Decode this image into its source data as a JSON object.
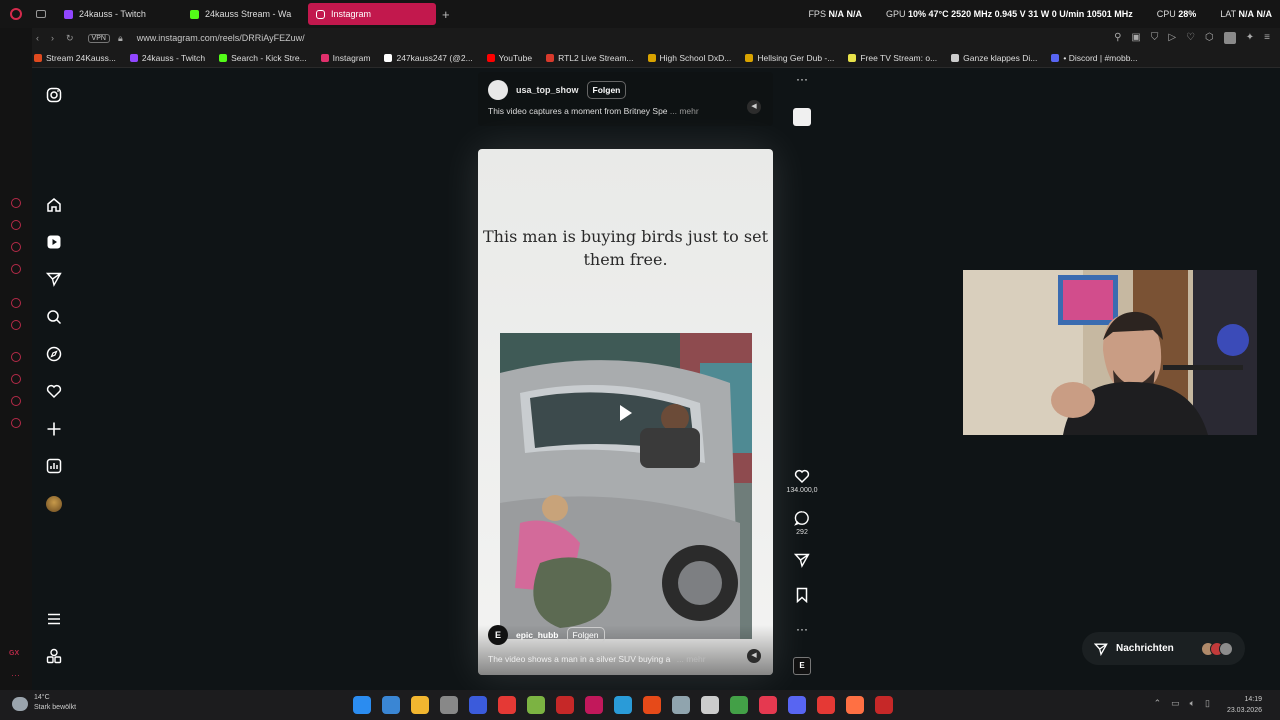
{
  "tabs": [
    {
      "label": "24kauss - Twitch",
      "color": "#9146ff",
      "active": false
    },
    {
      "label": "24kauss Stream - Wa",
      "color": "#53fc18",
      "active": false
    },
    {
      "label": "Instagram",
      "color": "#ffffff",
      "active": true
    }
  ],
  "stats": {
    "fps_label": "FPS",
    "fps_val": "N/A",
    "fps_val2": "N/A",
    "gpu_label": "GPU",
    "gpu_vals": "10% 47°C 2520 MHz 0.945 V 31 W 0 U/min 10501 MHz",
    "cpu_label": "CPU",
    "cpu_val": "28%",
    "lat_label": "LAT",
    "lat_val": "N/A",
    "lat_val2": "N/A"
  },
  "address": {
    "vpn": "VPN",
    "url": "www.instagram.com/reels/DRRiAyFEZuw/"
  },
  "bookmarks": [
    {
      "label": "Stream 24Kauss...",
      "color": "#e04a1f"
    },
    {
      "label": "24kauss - Twitch",
      "color": "#9146ff"
    },
    {
      "label": "Search - Kick Stre...",
      "color": "#53fc18"
    },
    {
      "label": "Instagram",
      "color": "#e1306c"
    },
    {
      "label": "247kauss247 (@2...",
      "color": "#ffffff"
    },
    {
      "label": "YouTube",
      "color": "#ff0000"
    },
    {
      "label": "RTL2 Live Stream...",
      "color": "#d83a2c"
    },
    {
      "label": "High School DxD...",
      "color": "#d9a300"
    },
    {
      "label": "Hellsing Ger Dub -...",
      "color": "#d9a300"
    },
    {
      "label": "Free TV Stream: o...",
      "color": "#e8e24a"
    },
    {
      "label": "Ganze klappes Di...",
      "color": "#cccccc"
    },
    {
      "label": "• Discord | #mobb...",
      "color": "#5865f2"
    }
  ],
  "reel_top": {
    "account": "usa_top_show",
    "follow": "Folgen",
    "caption": "This video captures a moment from Britney Spe",
    "more": "... mehr"
  },
  "reel_main": {
    "headline": "This man is buying birds just to set them free.",
    "account": "epic_hubb",
    "avatar_letter": "E",
    "follow": "Folgen",
    "caption": "The video shows a man in a silver SUV buying a",
    "more": "... mehr"
  },
  "actions": {
    "likes": "134.000,0",
    "comments": "292",
    "avatar_letter": "E"
  },
  "messages": {
    "label": "Nachrichten"
  },
  "taskbar": {
    "temp": "14°C",
    "weather": "Stark bewölkt",
    "time": "14:19",
    "date": "23.03.2026",
    "icon_colors": [
      "#2b8cf0",
      "#3a86d4",
      "#f2b630",
      "#888888",
      "#3b5bdb",
      "#e53935",
      "#7cb342",
      "#c62828",
      "#c2185b",
      "#2a9bd8",
      "#e64a19",
      "#90a4ae",
      "#cccccc",
      "#43a047",
      "#e53950",
      "#5865f2",
      "#e53935",
      "#ff7043",
      "#c62828"
    ]
  }
}
